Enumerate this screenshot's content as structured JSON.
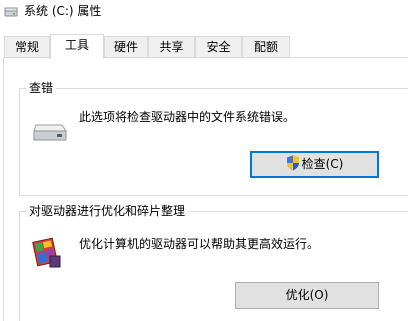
{
  "window": {
    "title": "系统 (C:) 属性",
    "title_icon": "drive-icon"
  },
  "tabs": [
    {
      "label": "常规",
      "active": false
    },
    {
      "label": "工具",
      "active": true
    },
    {
      "label": "硬件",
      "active": false
    },
    {
      "label": "共享",
      "active": false
    },
    {
      "label": "安全",
      "active": false
    },
    {
      "label": "配额",
      "active": false
    }
  ],
  "error_check": {
    "title": "查错",
    "description": "此选项将检查驱动器中的文件系统错误。",
    "button_label": "检查(C)",
    "icon": "hard-drive-icon",
    "button_icon": "uac-shield-icon"
  },
  "optimize": {
    "title": "对驱动器进行优化和碎片整理",
    "description": "优化计算机的驱动器可以帮助其更高效运行。",
    "button_label": "优化(O)",
    "icon": "defrag-icon"
  },
  "colors": {
    "focus_border": "#0078d7",
    "button_face": "#e1e1e1",
    "tab_inactive": "#f0f0f0"
  }
}
